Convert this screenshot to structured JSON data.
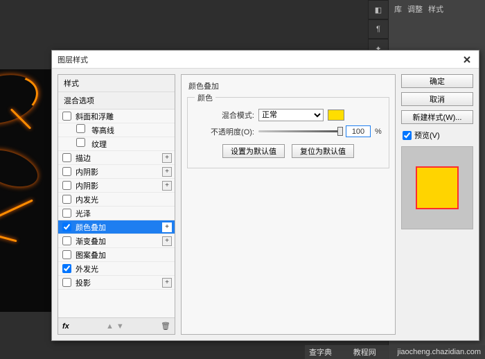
{
  "dialog": {
    "title": "图层样式",
    "close_icon": "close"
  },
  "style_list": {
    "header1": "样式",
    "header2": "混合选项",
    "items": [
      {
        "label": "斜面和浮雕",
        "checked": false,
        "has_add": false,
        "sub": false
      },
      {
        "label": "等高线",
        "checked": false,
        "has_add": false,
        "sub": true
      },
      {
        "label": "纹理",
        "checked": false,
        "has_add": false,
        "sub": true
      },
      {
        "label": "描边",
        "checked": false,
        "has_add": true,
        "sub": false
      },
      {
        "label": "内阴影",
        "checked": false,
        "has_add": true,
        "sub": false
      },
      {
        "label": "内阴影",
        "checked": false,
        "has_add": true,
        "sub": false
      },
      {
        "label": "内发光",
        "checked": false,
        "has_add": false,
        "sub": false
      },
      {
        "label": "光泽",
        "checked": false,
        "has_add": false,
        "sub": false
      },
      {
        "label": "颜色叠加",
        "checked": true,
        "has_add": true,
        "sub": false,
        "selected": true
      },
      {
        "label": "渐变叠加",
        "checked": false,
        "has_add": true,
        "sub": false
      },
      {
        "label": "图案叠加",
        "checked": false,
        "has_add": false,
        "sub": false
      },
      {
        "label": "外发光",
        "checked": true,
        "has_add": false,
        "sub": false
      },
      {
        "label": "投影",
        "checked": false,
        "has_add": true,
        "sub": false
      }
    ],
    "footer_fx": "fx"
  },
  "settings": {
    "group_title": "颜色叠加",
    "fieldset_legend": "颜色",
    "blend_label": "混合模式:",
    "blend_value": "正常",
    "opacity_label": "不透明度(O):",
    "opacity_value": "100",
    "opacity_unit": "%",
    "swatch_color": "#ffde00",
    "set_default": "设置为默认值",
    "reset_default": "复位为默认值"
  },
  "right": {
    "ok": "确定",
    "cancel": "取消",
    "new_style": "新建样式(W)...",
    "preview_label": "预览(V)",
    "preview_checked": true
  },
  "panels": {
    "tab1": "库",
    "tab2": "调整",
    "tab3": "样式"
  },
  "watermark": {
    "left": "查字典",
    "right": "jiaocheng.chazidian.com",
    "mid": "教程网"
  }
}
